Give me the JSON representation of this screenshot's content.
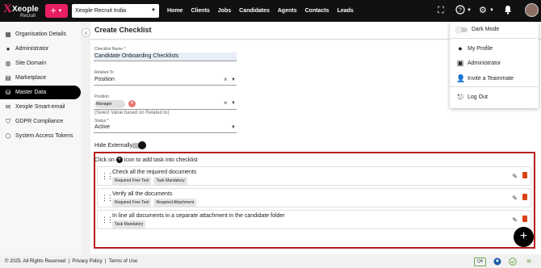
{
  "brand": {
    "name": "Xeople",
    "sub": "Recruit"
  },
  "topbar": {
    "company": "Xeople Recruit India",
    "nav": [
      "Home",
      "Clients",
      "Jobs",
      "Candidates",
      "Agents",
      "Contacts",
      "Leads"
    ]
  },
  "sidebar": {
    "items": [
      {
        "label": "Organisation Details",
        "icon": "org-icon"
      },
      {
        "label": "Administrator",
        "icon": "person-icon"
      },
      {
        "label": "Site Domain",
        "icon": "globe-icon"
      },
      {
        "label": "Marketplace",
        "icon": "marketplace-icon"
      },
      {
        "label": "Master Data",
        "icon": "database-icon"
      },
      {
        "label": "Xeople Smart-email",
        "icon": "email-icon"
      },
      {
        "label": "GDPR Compliance",
        "icon": "shield-icon"
      },
      {
        "label": "System Access Tokens",
        "icon": "token-icon"
      }
    ]
  },
  "page": {
    "title": "Create Checklist"
  },
  "form": {
    "name_label": "Checklist Name *",
    "name_value": "Candidate Onboarding Checklists",
    "related_label": "Related To",
    "related_value": "Position",
    "position_label": "Position",
    "position_chip": "Manager",
    "position_helper": "(Select Value based on Related to)",
    "status_label": "Status *",
    "status_value": "Active",
    "hide_label": "Hide Externally"
  },
  "tasks_hint": {
    "before": "Click on",
    "after": "icon to add task into checklist"
  },
  "tasks": [
    {
      "title": "Check all the required documents",
      "tags": [
        "Required Free Text",
        "Task Mandatory"
      ]
    },
    {
      "title": "Verify all the documents",
      "tags": [
        "Required Free Text",
        "Required Attachment"
      ]
    },
    {
      "title": "In line all documents in a separate attachment in the candidate folder",
      "tags": [
        "Task Mandatory"
      ]
    }
  ],
  "footer": {
    "copyright": "© 2025. All Rights Reserved",
    "privacy": "Privacy Policy",
    "terms": "Terms of Use",
    "badge": "QA"
  },
  "user_menu": {
    "dark_mode": "Dark Mode",
    "profile": "My Profile",
    "administrator": "Administrator",
    "invite": "Invite a Teammate",
    "logout": "Log Out"
  },
  "colors": {
    "accent": "#e91e63",
    "highlight_border": "#b71c1c",
    "trash": "#d84315"
  }
}
